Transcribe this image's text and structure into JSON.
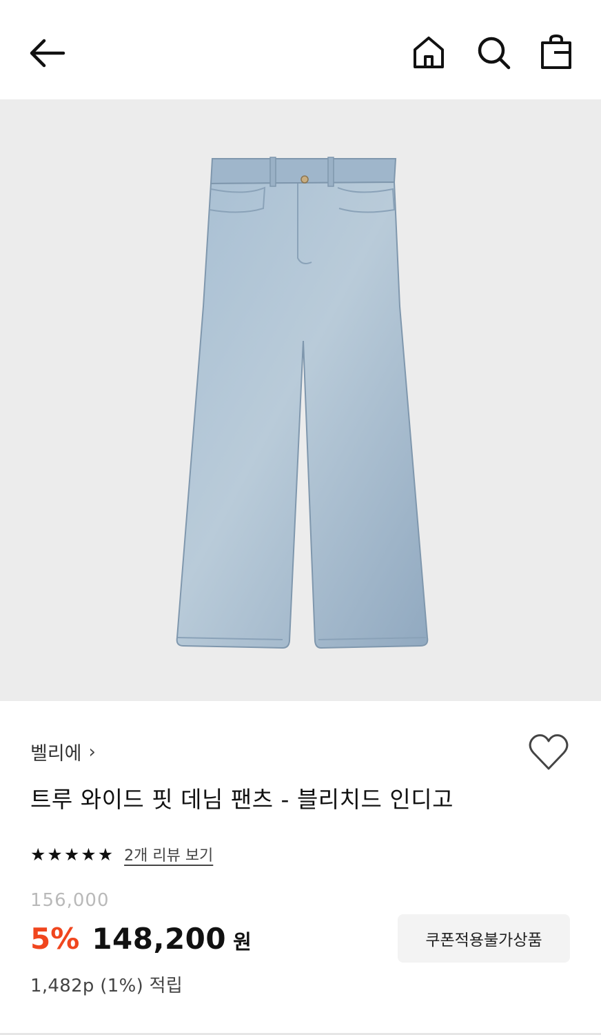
{
  "header": {
    "back_icon": "arrow-left-icon",
    "home_icon": "home-icon",
    "search_icon": "search-icon",
    "bag_icon": "shopping-bag-icon"
  },
  "product": {
    "image": "jeans-product-image",
    "brand": "벨리에",
    "brand_chevron": "›",
    "title": "트루 와이드 핏 데님 팬츠 - 블리치드 인디고",
    "rating_stars": 5,
    "review_link": "2개 리뷰 보기",
    "original_price": "156,000",
    "discount": "5%",
    "price": "148,200",
    "currency": "원",
    "points": "1,482p (1%) 적립",
    "coupon_label": "쿠폰적용불가상품"
  },
  "colors": {
    "discount": "#f0461e",
    "hero_bg": "#ececec",
    "denim": "#9db3c8"
  }
}
